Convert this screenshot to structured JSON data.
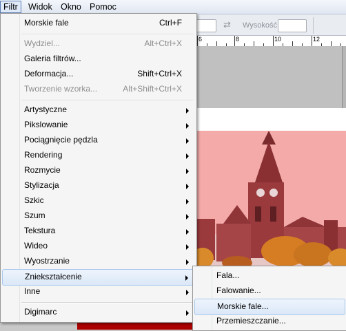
{
  "menubar": {
    "items": [
      "Filtr",
      "Widok",
      "Okno",
      "Pomoc"
    ]
  },
  "options": {
    "height_label": "Wysokość:"
  },
  "ruler": {
    "numbers": [
      "6",
      "8",
      "10",
      "12"
    ]
  },
  "filter_menu": {
    "last_filter": {
      "label": "Morskie fale",
      "shortcut": "Ctrl+F"
    },
    "extract": {
      "label": "Wydziel...",
      "shortcut": "Alt+Ctrl+X"
    },
    "gallery": {
      "label": "Galeria filtrów..."
    },
    "liquify": {
      "label": "Deformacja...",
      "shortcut": "Shift+Ctrl+X"
    },
    "pattern": {
      "label": "Tworzenie wzorka...",
      "shortcut": "Alt+Shift+Ctrl+X"
    },
    "categories": [
      "Artystyczne",
      "Pikslowanie",
      "Pociągnięcie pędzla",
      "Rendering",
      "Rozmycie",
      "Stylizacja",
      "Szkic",
      "Szum",
      "Tekstura",
      "Wideo",
      "Wyostrzanie",
      "Zniekształcenie",
      "Inne"
    ],
    "plugins": [
      "Digimarc"
    ]
  },
  "submenu": {
    "items": [
      "Fala...",
      "Falowanie...",
      "Morskie fale...",
      "Przemieszczanie..."
    ]
  },
  "colors": {
    "highlight": "#dbe8f8",
    "photo_tint": "#f3aaa9"
  }
}
